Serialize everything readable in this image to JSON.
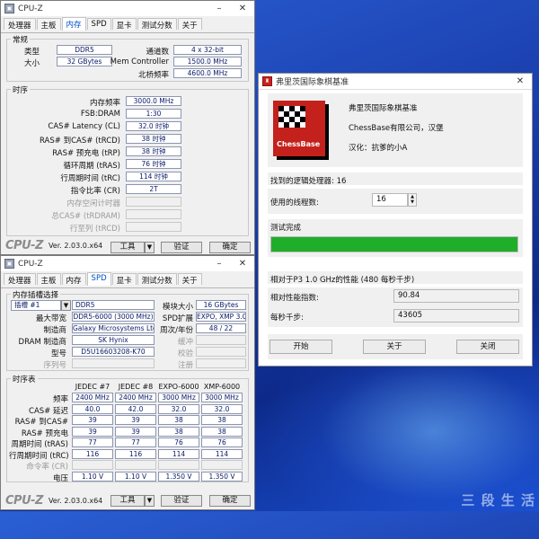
{
  "cpuz_top": {
    "title": "CPU-Z",
    "tabs": [
      "处理器",
      "主板",
      "内存",
      "SPD",
      "显卡",
      "测试分数",
      "关于"
    ],
    "active_tab": 2,
    "general": {
      "title": "常规",
      "type_label": "类型",
      "type_value": "DDR5",
      "size_label": "大小",
      "size_value": "32 GBytes",
      "channels_label": "通道数",
      "channels_value": "4 x 32-bit",
      "memctrl_label": "Mem Controller",
      "memctrl_value": "1500.0 MHz",
      "nb_label": "北桥频率",
      "nb_value": "4600.0 MHz"
    },
    "timings": {
      "title": "时序",
      "rows": [
        {
          "label": "内存频率",
          "value": "3000.0 MHz",
          "gray": false
        },
        {
          "label": "FSB:DRAM",
          "value": "1:30",
          "gray": false
        },
        {
          "label": "CAS# Latency (CL)",
          "value": "32.0 时钟",
          "gray": false
        },
        {
          "label": "RAS# 到CAS# (tRCD)",
          "value": "38 时钟",
          "gray": false
        },
        {
          "label": "RAS# 预充电 (tRP)",
          "value": "38 时钟",
          "gray": false
        },
        {
          "label": "循环周期 (tRAS)",
          "value": "76 时钟",
          "gray": false
        },
        {
          "label": "行周期时间 (tRC)",
          "value": "114 时钟",
          "gray": false
        },
        {
          "label": "指令比率 (CR)",
          "value": "2T",
          "gray": false
        },
        {
          "label": "内存空闲计时器",
          "value": "",
          "gray": true
        },
        {
          "label": "总CAS# (tRDRAM)",
          "value": "",
          "gray": true
        },
        {
          "label": "行至列 (tRCD)",
          "value": "",
          "gray": true
        }
      ]
    },
    "logo": "CPU-Z",
    "version": "Ver. 2.03.0.x64",
    "tools_label": "工具",
    "validate_label": "验证",
    "ok_label": "确定",
    "dropdown_arrow": "▼"
  },
  "cpuz_spd": {
    "title": "CPU-Z",
    "tabs": [
      "处理器",
      "主板",
      "内存",
      "SPD",
      "显卡",
      "测试分数",
      "关于"
    ],
    "active_tab": 3,
    "slot": {
      "title": "内存插槽选择",
      "slot_value": "插槽 #1",
      "type_value": "DDR5",
      "module_size_label": "模块大小",
      "module_size_value": "16 GBytes",
      "maxbw_label": "最大带宽",
      "maxbw_value": "DDR5-6000 (3000 MHz)",
      "spdext_label": "SPD扩展",
      "spdext_value": "EXPO, XMP 3.0",
      "mfr_label": "制造商",
      "mfr_value": "Galaxy Microsystems Ltd.",
      "week_label": "周次/年份",
      "week_value": "48 / 22",
      "dram_mfr_label": "DRAM 制造商",
      "dram_mfr_value": "SK Hynix",
      "buffered_label": "缓冲",
      "model_label": "型号",
      "model_value": "D5U16603208-K70",
      "checksum_label": "校验",
      "serial_label": "序列号",
      "registered_label": "注册"
    },
    "timing_table": {
      "title": "时序表",
      "columns": [
        "JEDEC #7",
        "JEDEC #8",
        "EXPO-6000",
        "XMP-6000"
      ],
      "rows": [
        {
          "label": "频率",
          "values": [
            "2400 MHz",
            "2400 MHz",
            "3000 MHz",
            "3000 MHz"
          ],
          "gray": false
        },
        {
          "label": "CAS# 延迟",
          "values": [
            "40.0",
            "42.0",
            "32.0",
            "32.0"
          ],
          "gray": false
        },
        {
          "label": "RAS# 到CAS#",
          "values": [
            "39",
            "39",
            "38",
            "38"
          ],
          "gray": false
        },
        {
          "label": "RAS# 预充电",
          "values": [
            "39",
            "39",
            "38",
            "38"
          ],
          "gray": false
        },
        {
          "label": "周期时间 (tRAS)",
          "values": [
            "77",
            "77",
            "76",
            "76"
          ],
          "gray": false
        },
        {
          "label": "行周期时间 (tRC)",
          "values": [
            "116",
            "116",
            "114",
            "114"
          ],
          "gray": false
        },
        {
          "label": "命令率 (CR)",
          "values": [
            "",
            "",
            "",
            ""
          ],
          "gray": true
        },
        {
          "label": "电压",
          "values": [
            "1.10 V",
            "1.10 V",
            "1.350 V",
            "1.350 V"
          ],
          "gray": false
        }
      ]
    },
    "logo": "CPU-Z",
    "version": "Ver. 2.03.0.x64",
    "tools_label": "工具",
    "validate_label": "验证",
    "ok_label": "确定",
    "dropdown_arrow": "▼"
  },
  "chessbase": {
    "title": "弗里茨国际象棋基准",
    "logo_text": "ChessBase",
    "app_name": "弗里茨国际象棋基准",
    "company": "ChessBase有限公司，汉堡",
    "localization": "汉化：抗爹的小A",
    "processors_found": "找到的逻辑处理器: 16",
    "threads_label": "使用的线程数:",
    "threads_value": "16",
    "status": "测试完成",
    "progress": 1.0,
    "progress_color": "#1fae2a",
    "perf_label": "相对于P3 1.0 GHz的性能 (480 每秒千步)",
    "ratio_label": "相对性能指数:",
    "ratio_value": "90.84",
    "kns_label": "每秒千步:",
    "kns_value": "43605",
    "start_label": "开始",
    "about_label": "关于",
    "close_label": "关闭"
  },
  "watermark": "三 段 生 活"
}
